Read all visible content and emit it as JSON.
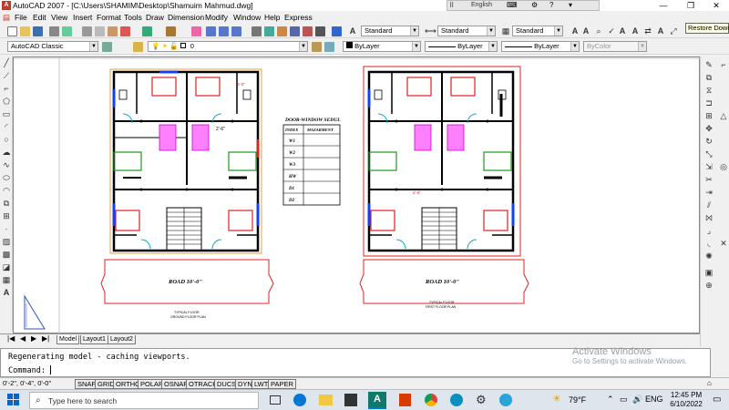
{
  "window": {
    "title": "AutoCAD 2007 - [C:\\Users\\SHAMIM\\Desktop\\Shamuim Mahmud.dwg]",
    "minimize_glyph": "—",
    "maximize_glyph": "❐",
    "close_glyph": "✕",
    "restore_tooltip": "Restore Down"
  },
  "ime_bar": {
    "language": "English"
  },
  "menu": [
    "File",
    "Edit",
    "View",
    "Insert",
    "Format",
    "Tools",
    "Draw",
    "Dimension",
    "Modify",
    "Window",
    "Help",
    "Express"
  ],
  "toolbar": {
    "workspace": "AutoCAD Classic",
    "layer": "0",
    "text_style": "Standard",
    "dim_style": "Standard",
    "table_style": "Standard",
    "color": "ByLayer",
    "linetype": "ByLayer",
    "lineweight": "ByLayer",
    "plot_style": "ByColor"
  },
  "drawing": {
    "schedule": {
      "title": "DOOR-WINDOW SEDUL",
      "headers": [
        "INDEX",
        "MAZARMENT"
      ],
      "rows": [
        "W1",
        "W2",
        "W3",
        "HW",
        "D1",
        "D2"
      ]
    },
    "road_left": "ROAD 10'-0\"",
    "road_right": "ROAD 10'-0\"",
    "dim_top": "5'-0\"",
    "dim_mid": "2'-6\"",
    "dim_right_mid": "2'-6\"",
    "caption_left": [
      "TYPICAL FLOOR",
      "GROUND FLOOR PLAN"
    ],
    "caption_right": [
      "TYPICAL FLOOR",
      "FIRST FLOOR PLAN"
    ]
  },
  "layout_tabs": [
    "Model",
    "Layout1",
    "Layout2"
  ],
  "command": {
    "history": "Regenerating model - caching viewports.",
    "prompt": "Command:"
  },
  "status": {
    "coords": "0'-2\", 0'-4\", 0'-0\"",
    "toggles": [
      "SNAP",
      "GRID",
      "ORTHO",
      "POLAR",
      "OSNAP",
      "OTRACK",
      "DUCS",
      "DYN",
      "LWT",
      "PAPER"
    ]
  },
  "activation": {
    "title": "Activate Windows",
    "subtitle": "Go to Settings to activate Windows."
  },
  "taskbar": {
    "search_placeholder": "Type here to search",
    "weather": "79°F",
    "time": "12:45 PM",
    "date": "6/10/2022",
    "colors": {
      "autocad": "#0e7a6e",
      "office": "#d83b01",
      "chrome": "#4285f4",
      "edge": "#0078d4"
    }
  }
}
